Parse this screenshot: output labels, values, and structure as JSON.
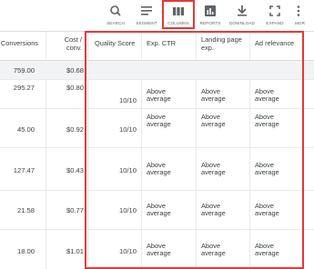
{
  "toolbar": {
    "items": [
      {
        "label": "SEARCH",
        "icon": "search-icon"
      },
      {
        "label": "SEGMENT",
        "icon": "segment-icon"
      },
      {
        "label": "COLUMNS",
        "icon": "columns-icon"
      },
      {
        "label": "REPORTS",
        "icon": "reports-icon"
      },
      {
        "label": "DOWNLOAD",
        "icon": "download-icon"
      },
      {
        "label": "EXPAND",
        "icon": "expand-icon"
      },
      {
        "label": "MOR",
        "icon": "more-icon"
      }
    ]
  },
  "table": {
    "headers": {
      "conversions": "Conversions",
      "cost_conv_line1": "Cost /",
      "cost_conv_line2": "conv.",
      "quality_score": "Quality Score",
      "exp_ctr": "Exp. CTR",
      "landing_line1": "Landing page",
      "landing_line2": "exp.",
      "ad_relevance": "Ad relevance"
    },
    "total_row": {
      "conversions": "759.00",
      "cost_conv": "$0.68"
    },
    "rows": [
      {
        "conversions": "295.27",
        "cost_conv": "$0.80",
        "quality_score": "10/10",
        "exp_ctr_1": "Above",
        "exp_ctr_2": "average",
        "landing_1": "Above",
        "landing_2": "average",
        "ad_rel_1": "Above",
        "ad_rel_2": "average"
      },
      {
        "conversions": "45.00",
        "cost_conv": "$0.92",
        "quality_score": "10/10",
        "exp_ctr_1": "Above",
        "exp_ctr_2": "average",
        "landing_1": "Above",
        "landing_2": "average",
        "ad_rel_1": "Above",
        "ad_rel_2": "average"
      },
      {
        "conversions": "127.47",
        "cost_conv": "$0.43",
        "quality_score": "10/10",
        "exp_ctr_1": "Above",
        "exp_ctr_2": "average",
        "landing_1": "Above",
        "landing_2": "average",
        "ad_rel_1": "Above",
        "ad_rel_2": "average"
      },
      {
        "conversions": "21.58",
        "cost_conv": "$0.77",
        "quality_score": "10/10",
        "exp_ctr_1": "Above",
        "exp_ctr_2": "average",
        "landing_1": "Above",
        "landing_2": "average",
        "ad_rel_1": "Above",
        "ad_rel_2": "average"
      },
      {
        "conversions": "18.00",
        "cost_conv": "$1.01",
        "quality_score": "10/10",
        "exp_ctr_1": "Above",
        "exp_ctr_2": "average",
        "landing_1": "Above",
        "landing_2": "average",
        "ad_rel_1": "Above",
        "ad_rel_2": "average"
      }
    ]
  },
  "colors": {
    "highlight": "#e53935",
    "icon": "#5f6368",
    "text": "#3c4043"
  }
}
